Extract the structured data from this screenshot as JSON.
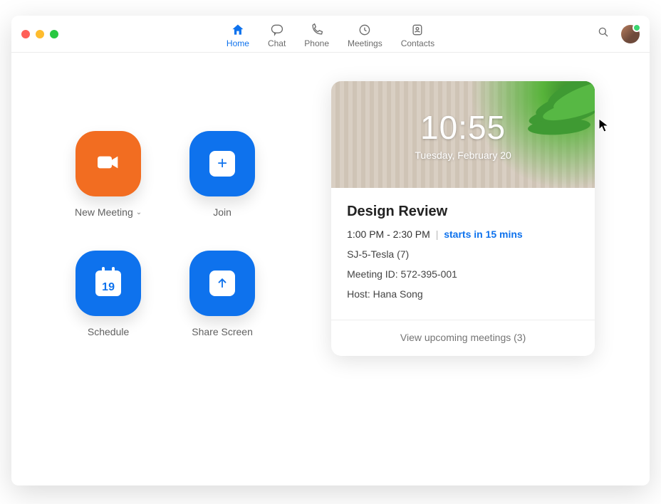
{
  "nav": {
    "home": "Home",
    "chat": "Chat",
    "phone": "Phone",
    "meetings": "Meetings",
    "contacts": "Contacts"
  },
  "tiles": {
    "new_meeting": "New Meeting",
    "join": "Join",
    "schedule": "Schedule",
    "share_screen": "Share Screen",
    "calendar_day": "19"
  },
  "clock": {
    "time": "10:55",
    "date": "Tuesday, February 20"
  },
  "meeting": {
    "title": "Design Review",
    "time_range": "1:00 PM - 2:30 PM",
    "divider": "|",
    "starts_in": "starts in 15 mins",
    "room": "SJ-5-Tesla (7)",
    "id_label": "Meeting ID: 572-395-001",
    "host_label": "Host: Hana Song"
  },
  "footer": {
    "upcoming": "View upcoming meetings (3)"
  }
}
